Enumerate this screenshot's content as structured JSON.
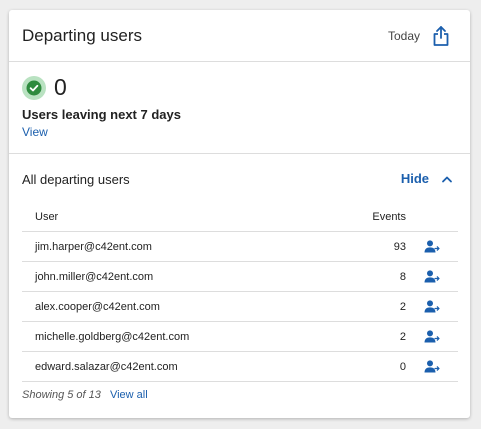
{
  "card": {
    "title": "Departing users",
    "range": "Today",
    "export_icon": "share-export-icon"
  },
  "summary": {
    "count": "0",
    "label": "Users leaving next 7 days",
    "link": "View",
    "status_icon": "check-circle-icon",
    "status_color": "#2e8b3e"
  },
  "section": {
    "title": "All departing users",
    "toggle_label": "Hide",
    "toggle_icon": "chevron-up-icon"
  },
  "table": {
    "columns": [
      "User",
      "Events"
    ],
    "rows": [
      {
        "user": "jim.harper@c42ent.com",
        "events": "93"
      },
      {
        "user": "john.miller@c42ent.com",
        "events": "8"
      },
      {
        "user": "alex.cooper@c42ent.com",
        "events": "2"
      },
      {
        "user": "michelle.goldberg@c42ent.com",
        "events": "2"
      },
      {
        "user": "edward.salazar@c42ent.com",
        "events": "0"
      }
    ],
    "row_action_icon": "user-remove-icon"
  },
  "footer": {
    "showing": "Showing 5 of 13",
    "view_all": "View all"
  },
  "colors": {
    "link": "#1b5fad",
    "accent_icon": "#1b5fad",
    "check_bg": "#b9e2c1",
    "check_fg": "#2e8b3e"
  }
}
